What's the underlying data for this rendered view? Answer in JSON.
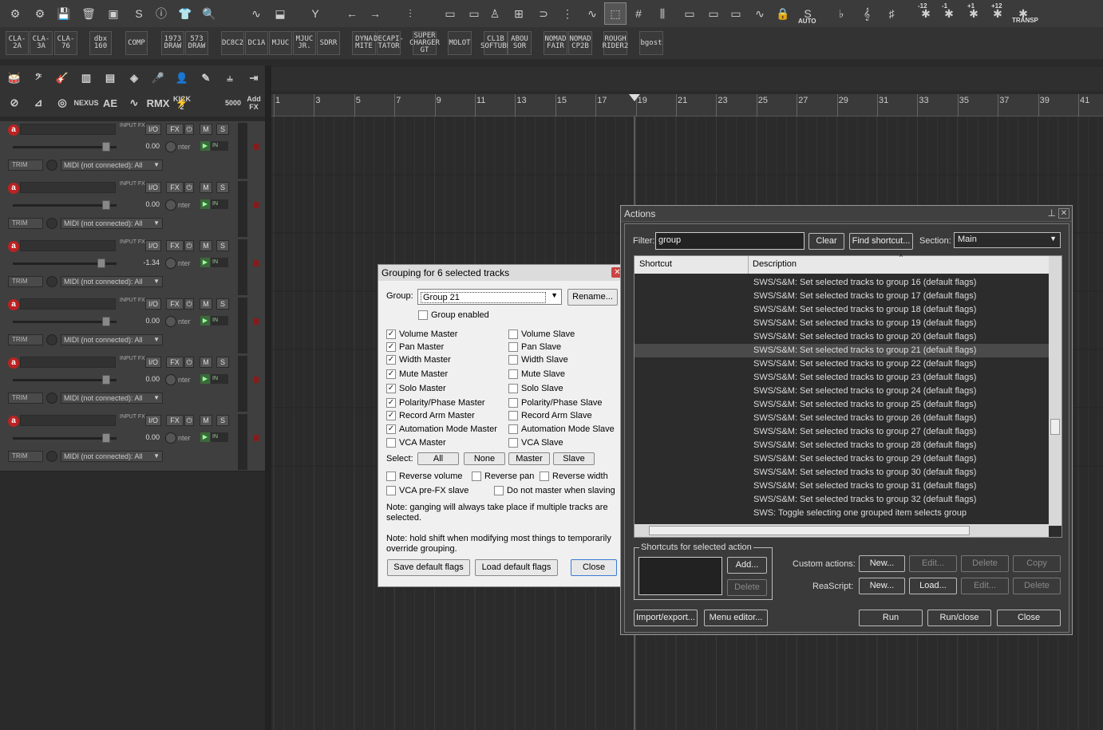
{
  "toolbar1": {
    "icons": [
      "gear-plus",
      "gear",
      "save",
      "trash",
      "envelope",
      "sws",
      "info",
      "shirt",
      "search",
      "waveform",
      "split",
      "funnel",
      "undo",
      "redo",
      "mixer",
      "mute-item",
      "mute-split",
      "metronome",
      "grid-view",
      "link",
      "dots",
      "envelope-curve",
      "select-cursor",
      "grid",
      "snap-lines",
      "ripple1",
      "ripple2",
      "ripple3",
      "env-points",
      "lock",
      "auto",
      "flat",
      "treble",
      "sharp",
      "minus12",
      "minus1",
      "plus1",
      "plus12",
      "transp"
    ],
    "labels": {
      "auto": "AUTO",
      "m12": "-12",
      "m1": "-1",
      "p1": "+1",
      "p12": "+12",
      "transp": "TRANSP"
    }
  },
  "toolbar2": {
    "plugins": [
      "CLA-2A",
      "CLA-3A",
      "CLA-76",
      "dbx 160",
      "COMP",
      "1973 DRAW",
      "573 DRAW",
      "DC8C2",
      "DC1A",
      "MJUC",
      "MJUC JR.",
      "SDRR",
      "DYNA MITE",
      "DECAPI-TATOR",
      "SUPER CHARGER GT",
      "MOLOT",
      "CL1B SOFTUBE",
      "ABOU SOR",
      "NOMAD FAIR",
      "NOMAD CP2B",
      "ROUGH RIDER2",
      "bgost"
    ]
  },
  "toolbar3": {
    "icons": [
      "drums",
      "bass",
      "guitar",
      "piano",
      "keyboard",
      "synth",
      "mic",
      "vocal",
      "brush",
      "harmonic",
      "arrow-right"
    ],
    "labels2": [
      "NEXUS",
      "KICK 2",
      "5000",
      "Add FX"
    ]
  },
  "ruler": {
    "marks": [
      "1",
      "3",
      "5",
      "7",
      "9",
      "11",
      "13",
      "15",
      "17",
      "19",
      "21",
      "23",
      "25",
      "27",
      "29",
      "31",
      "33",
      "35",
      "37",
      "39",
      "41"
    ]
  },
  "tracks": [
    {
      "volume": "0.00",
      "pan_label": "nter",
      "midi": "MIDI (not connected): All",
      "fx": "FX",
      "io": "I/O",
      "m": "M",
      "s": "S",
      "trim": "TRIM",
      "in": "IN",
      "input_fx": "INPUT FX"
    },
    {
      "volume": "0.00",
      "pan_label": "nter",
      "midi": "MIDI (not connected): All",
      "fx": "FX",
      "io": "I/O",
      "m": "M",
      "s": "S",
      "trim": "TRIM",
      "in": "IN",
      "input_fx": "INPUT FX"
    },
    {
      "volume": "-1.34",
      "pan_label": "nter",
      "midi": "MIDI (not connected): All",
      "fx": "FX",
      "io": "I/O",
      "m": "M",
      "s": "S",
      "trim": "TRIM",
      "in": "IN",
      "input_fx": "INPUT FX"
    },
    {
      "volume": "0.00",
      "pan_label": "nter",
      "midi": "MIDI (not connected): All",
      "fx": "FX",
      "io": "I/O",
      "m": "M",
      "s": "S",
      "trim": "TRIM",
      "in": "IN",
      "input_fx": "INPUT FX"
    },
    {
      "volume": "0.00",
      "pan_label": "nter",
      "midi": "MIDI (not connected): All",
      "fx": "FX",
      "io": "I/O",
      "m": "M",
      "s": "S",
      "trim": "TRIM",
      "in": "IN",
      "input_fx": "INPUT FX"
    },
    {
      "volume": "0.00",
      "pan_label": "nter",
      "midi": "MIDI (not connected): All",
      "fx": "FX",
      "io": "I/O",
      "m": "M",
      "s": "S",
      "trim": "TRIM",
      "in": "IN",
      "input_fx": "INPUT FX"
    }
  ],
  "grouping": {
    "title": "Grouping for 6 selected tracks",
    "group_label": "Group:",
    "group_value": "Group 21",
    "rename": "Rename...",
    "group_enabled": "Group enabled",
    "masters": [
      {
        "label": "Volume Master",
        "checked": true
      },
      {
        "label": "Pan Master",
        "checked": true
      },
      {
        "label": "Width Master",
        "checked": true
      },
      {
        "label": "Mute Master",
        "checked": true
      },
      {
        "label": "Solo Master",
        "checked": true
      },
      {
        "label": "Polarity/Phase Master",
        "checked": true
      },
      {
        "label": "Record Arm Master",
        "checked": true
      },
      {
        "label": "Automation Mode Master",
        "checked": true
      },
      {
        "label": "VCA Master",
        "checked": false
      }
    ],
    "slaves": [
      {
        "label": "Volume Slave",
        "checked": false
      },
      {
        "label": "Pan Slave",
        "checked": false
      },
      {
        "label": "Width Slave",
        "checked": false
      },
      {
        "label": "Mute Slave",
        "checked": false
      },
      {
        "label": "Solo Slave",
        "checked": false
      },
      {
        "label": "Polarity/Phase Slave",
        "checked": false
      },
      {
        "label": "Record Arm Slave",
        "checked": false
      },
      {
        "label": "Automation Mode Slave",
        "checked": false
      },
      {
        "label": "VCA Slave",
        "checked": false
      }
    ],
    "select_label": "Select:",
    "select_buttons": [
      "All",
      "None",
      "Master",
      "Slave"
    ],
    "reverse_volume": "Reverse volume",
    "reverse_pan": "Reverse pan",
    "reverse_width": "Reverse width",
    "vca_prefx": "VCA pre-FX slave",
    "no_master": "Do not master when slaving",
    "note1": "Note: ganging will always take place if multiple tracks are selected.",
    "note2": "Note: hold shift when modifying most things to temporarily override grouping.",
    "save_default": "Save default flags",
    "load_default": "Load default flags",
    "close": "Close"
  },
  "actions": {
    "title": "Actions",
    "filter_label": "Filter:",
    "filter_value": "group",
    "clear": "Clear",
    "find_shortcut": "Find shortcut...",
    "section_label": "Section:",
    "section_value": "Main",
    "col_shortcut": "Shortcut",
    "col_description": "Description",
    "rows": [
      "SWS/S&M: Set selected tracks to group 16 (default flags)",
      "SWS/S&M: Set selected tracks to group 17 (default flags)",
      "SWS/S&M: Set selected tracks to group 18 (default flags)",
      "SWS/S&M: Set selected tracks to group 19 (default flags)",
      "SWS/S&M: Set selected tracks to group 20 (default flags)",
      "SWS/S&M: Set selected tracks to group 21 (default flags)",
      "SWS/S&M: Set selected tracks to group 22 (default flags)",
      "SWS/S&M: Set selected tracks to group 23 (default flags)",
      "SWS/S&M: Set selected tracks to group 24 (default flags)",
      "SWS/S&M: Set selected tracks to group 25 (default flags)",
      "SWS/S&M: Set selected tracks to group 26 (default flags)",
      "SWS/S&M: Set selected tracks to group 27 (default flags)",
      "SWS/S&M: Set selected tracks to group 28 (default flags)",
      "SWS/S&M: Set selected tracks to group 29 (default flags)",
      "SWS/S&M: Set selected tracks to group 30 (default flags)",
      "SWS/S&M: Set selected tracks to group 31 (default flags)",
      "SWS/S&M: Set selected tracks to group 32 (default flags)",
      "SWS: Toggle selecting one grouped item selects group"
    ],
    "selected_index": 5,
    "shortcuts_label": "Shortcuts for selected action",
    "add": "Add...",
    "delete": "Delete",
    "custom_label": "Custom actions:",
    "reascript_label": "ReaScript:",
    "new": "New...",
    "edit": "Edit...",
    "copy": "Copy",
    "load": "Load...",
    "import_export": "Import/export...",
    "menu_editor": "Menu editor...",
    "run": "Run",
    "run_close": "Run/close",
    "close": "Close"
  }
}
